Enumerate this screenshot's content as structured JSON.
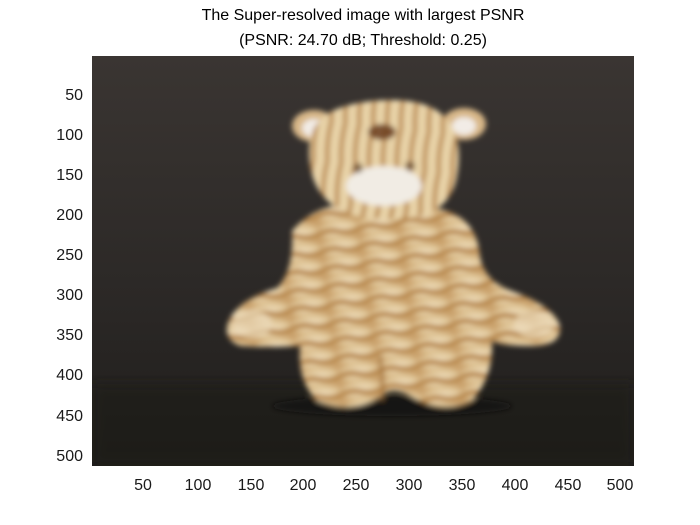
{
  "figure": {
    "title_line1": "The Super-resolved image with largest PSNR",
    "title_line2": "(PSNR: 24.70 dB; Threshold:  0.25)"
  },
  "axes": {
    "x_ticks": [
      "50",
      "100",
      "150",
      "200",
      "250",
      "300",
      "350",
      "400",
      "450",
      "500"
    ],
    "y_ticks": [
      "50",
      "100",
      "150",
      "200",
      "250",
      "300",
      "350",
      "400",
      "450",
      "500"
    ],
    "x_range": [
      1,
      512
    ],
    "y_range": [
      1,
      512
    ],
    "y_direction": "reversed"
  },
  "image": {
    "subject": "stuffed-tiger-toy",
    "colors": {
      "background": "#2f2c2a",
      "fur_light": "#ead8b4",
      "stripe": "#b07a3a",
      "muzzle": "#f1ece4"
    }
  }
}
